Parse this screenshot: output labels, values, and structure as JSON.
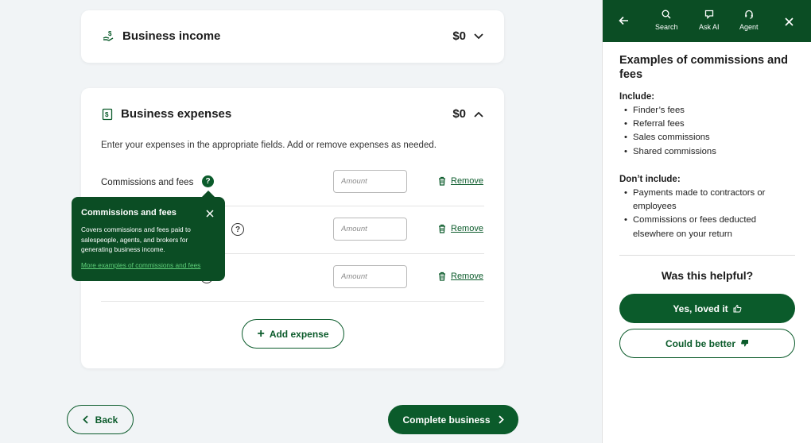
{
  "income_card": {
    "title": "Business income",
    "amount": "$0"
  },
  "expenses_card": {
    "title": "Business expenses",
    "amount": "$0",
    "intro": "Enter your expenses in the appropriate fields. Add or remove expenses as needed.",
    "rows": [
      {
        "label": "Commissions and fees",
        "placeholder": "Amount",
        "remove_label": "Remove"
      },
      {
        "label": "",
        "placeholder": "Amount",
        "remove_label": "Remove"
      },
      {
        "label": "",
        "placeholder": "Amount",
        "remove_label": "Remove"
      }
    ],
    "add_label": "Add expense"
  },
  "tooltip": {
    "title": "Commissions and fees",
    "body": "Covers commissions and fees paid to salespeople, agents, and brokers for generating business income.",
    "link": "More examples of commissions and fees"
  },
  "footer": {
    "back_label": "Back",
    "complete_label": "Complete business"
  },
  "panel": {
    "tools": {
      "search": "Search",
      "ask_ai": "Ask AI",
      "agent": "Agent"
    },
    "title": "Examples of commissions and fees",
    "include_label": "Include:",
    "include_items": [
      "Finder’s fees",
      "Referral fees",
      "Sales commissions",
      "Shared commissions"
    ],
    "exclude_label": "Don’t include:",
    "exclude_items": [
      "Payments made to contractors or employees",
      "Commissions or fees deducted elsewhere on your return"
    ],
    "helpful_question": "Was this helpful?",
    "yes_label": "Yes, loved it",
    "better_label": "Could be better"
  },
  "colors": {
    "brand_green": "#0b5b2b",
    "header_green": "#0b4d24",
    "link_green": "#5fd07a"
  }
}
